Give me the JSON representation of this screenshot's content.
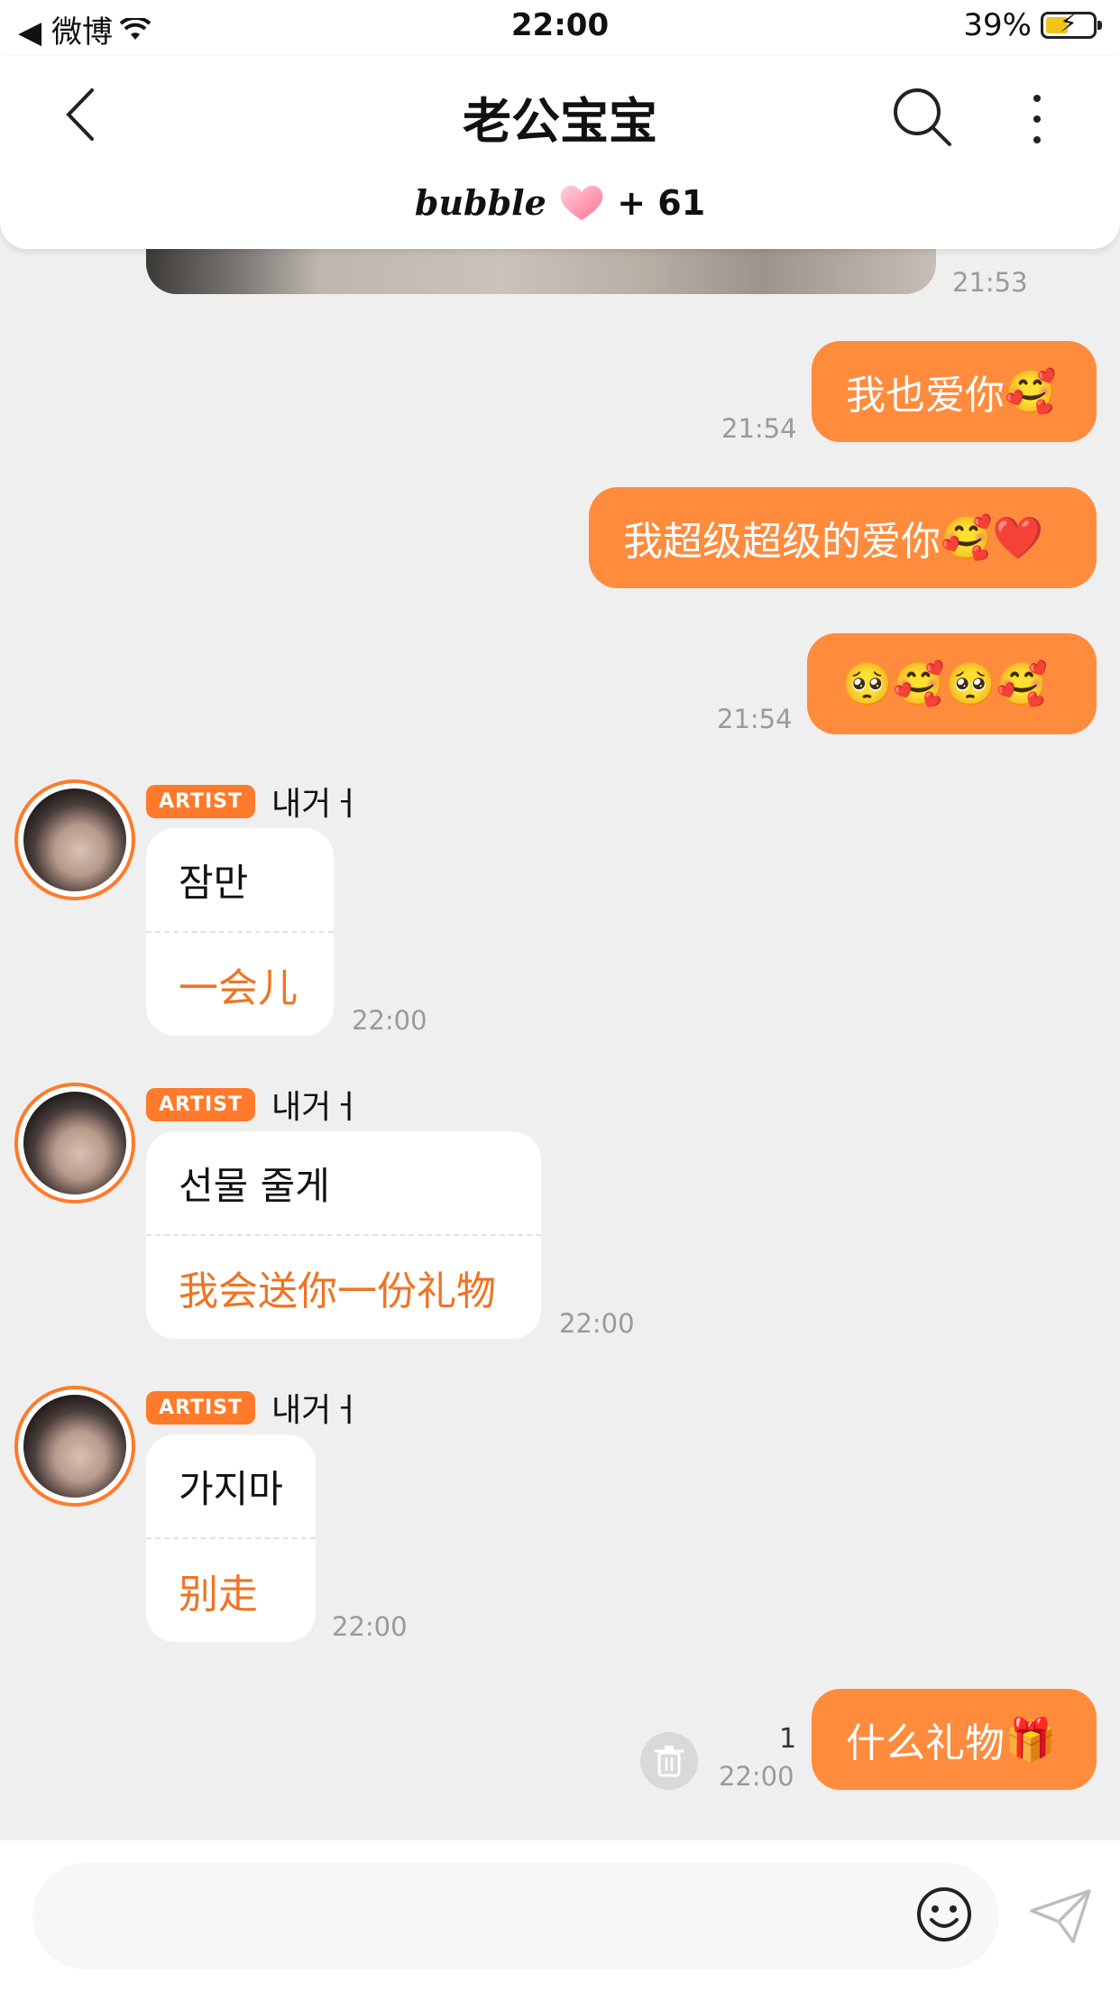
{
  "status_bar": {
    "back_app": "◀ 微博",
    "time": "22:00",
    "battery": "39%"
  },
  "header": {
    "title": "老公宝宝",
    "bubble_brand": "bubble",
    "bubble_count": "+ 61"
  },
  "chat": {
    "photo_time": "21:53",
    "outgoing": [
      {
        "text": "我也爱你",
        "emoji": "🥰",
        "time": "21:54"
      },
      {
        "text": "我超级超级的爱你",
        "emoji": "🥰❤️",
        "time": ""
      },
      {
        "text": "",
        "emoji": "🥺🥰🥺🥰",
        "time": "21:54"
      }
    ],
    "artist_badge": "ARTIST",
    "artist_name": "내거ㅓ",
    "incoming": [
      {
        "original": "잠만",
        "translation": "一会儿",
        "time": "22:00"
      },
      {
        "original": "선물 줄게",
        "translation": "我会送你一份礼物",
        "time": "22:00"
      },
      {
        "original": "가지마",
        "translation": "别走",
        "time": "22:00"
      }
    ],
    "last_outgoing": {
      "text": "什么礼物",
      "emoji": "🎁",
      "time": "22:00",
      "unread": "1"
    }
  },
  "input": {
    "placeholder": ""
  },
  "colors": {
    "accent": "#ff8b3d",
    "translation": "#f07322",
    "background": "#efefef"
  },
  "icons": [
    "back-arrow-icon",
    "search-icon",
    "more-vertical-icon",
    "heart-icon",
    "trash-icon",
    "emoji-icon",
    "send-icon",
    "wifi-icon",
    "battery-icon"
  ]
}
